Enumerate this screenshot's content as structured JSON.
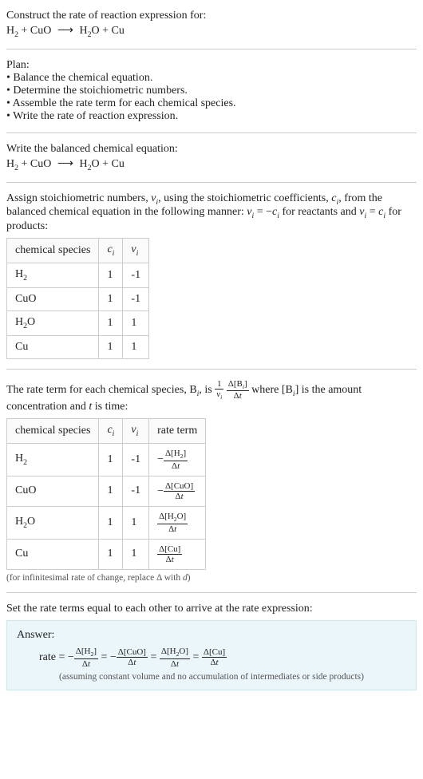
{
  "intro": {
    "prompt": "Construct the rate of reaction expression for:",
    "equation_html": "H<span class=\"sub\">2</span> + CuO <span class=\"arrow\">⟶</span> H<span class=\"sub\">2</span>O + Cu"
  },
  "plan": {
    "heading": "Plan:",
    "items": [
      "Balance the chemical equation.",
      "Determine the stoichiometric numbers.",
      "Assemble the rate term for each chemical species.",
      "Write the rate of reaction expression."
    ]
  },
  "balanced": {
    "heading": "Write the balanced chemical equation:",
    "equation_html": "H<span class=\"sub\">2</span> + CuO <span class=\"arrow\">⟶</span> H<span class=\"sub\">2</span>O + Cu"
  },
  "stoich": {
    "text_html": "Assign stoichiometric numbers, <span class=\"math-i\">ν<span class=\"sub\">i</span></span>, using the stoichiometric coefficients, <span class=\"math-i\">c<span class=\"sub\">i</span></span>, from the balanced chemical equation in the following manner: <span class=\"math-i\">ν<span class=\"sub\">i</span></span> = −<span class=\"math-i\">c<span class=\"sub\">i</span></span> for reactants and <span class=\"math-i\">ν<span class=\"sub\">i</span></span> = <span class=\"math-i\">c<span class=\"sub\">i</span></span> for products:",
    "table": {
      "headers": {
        "species": "chemical species",
        "ci": "c_i",
        "nui": "ν_i"
      },
      "rows": [
        {
          "species_html": "H<span class=\"sub\">2</span>",
          "ci": "1",
          "nui": "-1"
        },
        {
          "species_html": "CuO",
          "ci": "1",
          "nui": "-1"
        },
        {
          "species_html": "H<span class=\"sub\">2</span>O",
          "ci": "1",
          "nui": "1"
        },
        {
          "species_html": "Cu",
          "ci": "1",
          "nui": "1"
        }
      ]
    }
  },
  "rateterm": {
    "text_before": "The rate term for each chemical species, B",
    "text_after_html": ", is <span class=\"frac\"><span class=\"num\">1</span><span class=\"den\"><span class=\"math-i\">ν<span class=\"sub\">i</span></span></span></span> <span class=\"frac\"><span class=\"num\">Δ[B<span class=\"sub\"><span class=\"math-i\">i</span></span>]</span><span class=\"den\">Δ<span class=\"math-i\">t</span></span></span> where [B<span class=\"sub\"><span class=\"math-i\">i</span></span>] is the amount concentration and <span class=\"math-i\">t</span> is time:",
    "table": {
      "headers": {
        "species": "chemical species",
        "ci": "c_i",
        "nui": "ν_i",
        "rate": "rate term"
      },
      "rows": [
        {
          "species_html": "H<span class=\"sub\">2</span>",
          "ci": "1",
          "nui": "-1",
          "rate_html": "−<span class=\"frac\"><span class=\"num\">Δ[H<span class=\"sub\">2</span>]</span><span class=\"den\">Δ<span class=\"math-i\">t</span></span></span>"
        },
        {
          "species_html": "CuO",
          "ci": "1",
          "nui": "-1",
          "rate_html": "−<span class=\"frac\"><span class=\"num\">Δ[CuO]</span><span class=\"den\">Δ<span class=\"math-i\">t</span></span></span>"
        },
        {
          "species_html": "H<span class=\"sub\">2</span>O",
          "ci": "1",
          "nui": "1",
          "rate_html": "<span class=\"frac\"><span class=\"num\">Δ[H<span class=\"sub\">2</span>O]</span><span class=\"den\">Δ<span class=\"math-i\">t</span></span></span>"
        },
        {
          "species_html": "Cu",
          "ci": "1",
          "nui": "1",
          "rate_html": "<span class=\"frac\"><span class=\"num\">Δ[Cu]</span><span class=\"den\">Δ<span class=\"math-i\">t</span></span></span>"
        }
      ]
    },
    "note_html": "(for infinitesimal rate of change, replace Δ with <span class=\"math-i\">d</span>)"
  },
  "final": {
    "heading": "Set the rate terms equal to each other to arrive at the rate expression:",
    "answer_label": "Answer:",
    "expression_html": "rate = −<span class=\"frac\"><span class=\"num\">Δ[H<span class=\"sub\">2</span>]</span><span class=\"den\">Δ<span class=\"math-i\">t</span></span></span> = −<span class=\"frac\"><span class=\"num\">Δ[CuO]</span><span class=\"den\">Δ<span class=\"math-i\">t</span></span></span> = <span class=\"frac\"><span class=\"num\">Δ[H<span class=\"sub\">2</span>O]</span><span class=\"den\">Δ<span class=\"math-i\">t</span></span></span> = <span class=\"frac\"><span class=\"num\">Δ[Cu]</span><span class=\"den\">Δ<span class=\"math-i\">t</span></span></span>",
    "assumption": "(assuming constant volume and no accumulation of intermediates or side products)"
  }
}
